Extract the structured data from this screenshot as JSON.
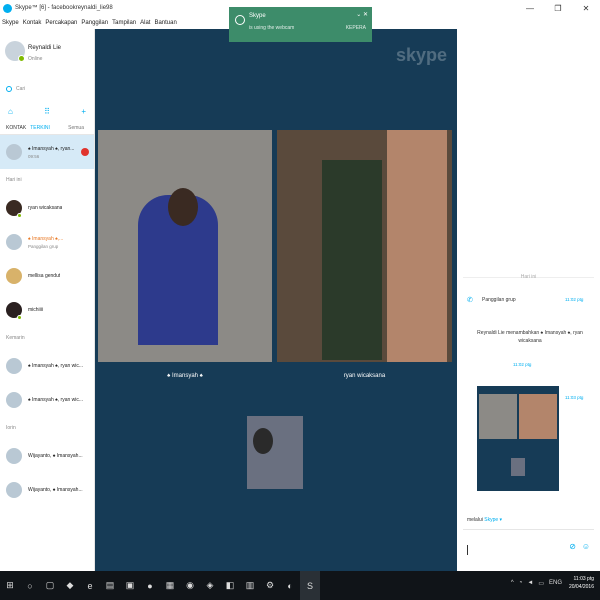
{
  "window": {
    "title": "Skype™ [6] - facebookreynaldi_lie98"
  },
  "menu": [
    "Skype",
    "Kontak",
    "Percakapan",
    "Panggilan",
    "Tampilan",
    "Alat",
    "Bantuan"
  ],
  "profile": {
    "name": "Reynaldi Lie",
    "status": "Online"
  },
  "search": {
    "placeholder": "Cari"
  },
  "tabs": {
    "contacts": "KONTAK",
    "recent": "TERKINI",
    "filter": "Semua"
  },
  "sidebar": {
    "today_label": "Hari ini",
    "yesterday_label": "Kemarin",
    "older_label": "Iorin",
    "items": [
      {
        "name": "♠ Imansyah ♠, ryan...",
        "sub": "09:56"
      },
      {
        "name": "ryan wicaksana",
        "sub": ""
      },
      {
        "name": "♠ Imansyah ♠,...",
        "sub": "Panggilan grup"
      },
      {
        "name": "mellisa gendut",
        "sub": ""
      },
      {
        "name": "michiiii",
        "sub": ""
      },
      {
        "name": "♠ Imansyah ♠, ryan wic...",
        "sub": ""
      },
      {
        "name": "♠ Imansyah ♠, ryan wic...",
        "sub": ""
      },
      {
        "name": "Wijayanto, ♠ Imansyah...",
        "sub": ""
      },
      {
        "name": "Wijayanto, ♠ Imansyah...",
        "sub": ""
      }
    ]
  },
  "toast": {
    "title": "Skype",
    "text": "is using the webcam",
    "right": "KEPERA"
  },
  "call": {
    "watermark": "skype",
    "participant1": "♠ Imansyah ♠",
    "participant2": "ryan wicaksana"
  },
  "chat": {
    "separator": "Hari ini",
    "call_row": "Panggilan grup",
    "call_time": "11:02 ptg",
    "message": "Reynaldi Lie menambahkan ♠ Imansyah ♠, ryan wicaksana",
    "message_time": "11:02 ptg",
    "thumb_time": "11:03 ptg",
    "via": "melalui",
    "via_link": "Skype ▾"
  },
  "clock": {
    "time": "11:03 ptg",
    "date": "20/04/2016"
  },
  "tray": {
    "lang": "ENG"
  }
}
